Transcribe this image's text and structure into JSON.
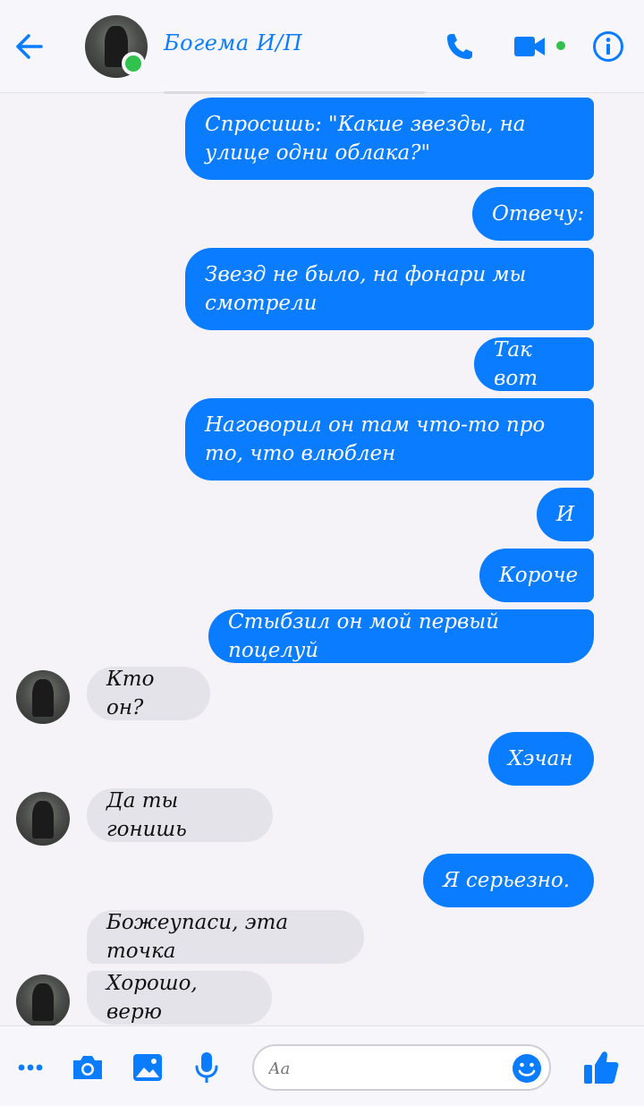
{
  "header": {
    "title": "Богема И/П",
    "icons": [
      "back-arrow-icon",
      "phone-icon",
      "video-camera-icon",
      "info-icon"
    ],
    "accent_color": "#0a7cff",
    "online_color": "#31c24d"
  },
  "messages": [
    {
      "dir": "out",
      "text": "Спросишь: \"Какие звезды, на улице одни облака?\""
    },
    {
      "dir": "out",
      "text": "Отвечу:"
    },
    {
      "dir": "out",
      "text": "Звезд не было, на фонари мы смотрели"
    },
    {
      "dir": "out",
      "text": "Так вот"
    },
    {
      "dir": "out",
      "text": "Наговорил он там что-то про то, что влюблен"
    },
    {
      "dir": "out",
      "text": "И"
    },
    {
      "dir": "out",
      "text": "Короче"
    },
    {
      "dir": "out",
      "text": "Стыбзил он мой первый поцелуй"
    },
    {
      "dir": "in",
      "text": "Кто он?"
    },
    {
      "dir": "out",
      "text": "Хэчан"
    },
    {
      "dir": "in",
      "text": "Да ты гонишь"
    },
    {
      "dir": "out",
      "text": "Я серьезно."
    },
    {
      "dir": "in",
      "text": "Божеупаси, эта точка"
    },
    {
      "dir": "in",
      "text": "Хорошо, верю"
    }
  ],
  "composer": {
    "placeholder": "Аа",
    "icons": [
      "more-icon",
      "camera-icon",
      "gallery-icon",
      "microphone-icon",
      "emoji-icon",
      "thumbs-up-icon"
    ]
  },
  "colors": {
    "outgoing_bubble": "#0a7cff",
    "incoming_bubble": "#e4e3e9",
    "background": "#f5f3f8"
  }
}
